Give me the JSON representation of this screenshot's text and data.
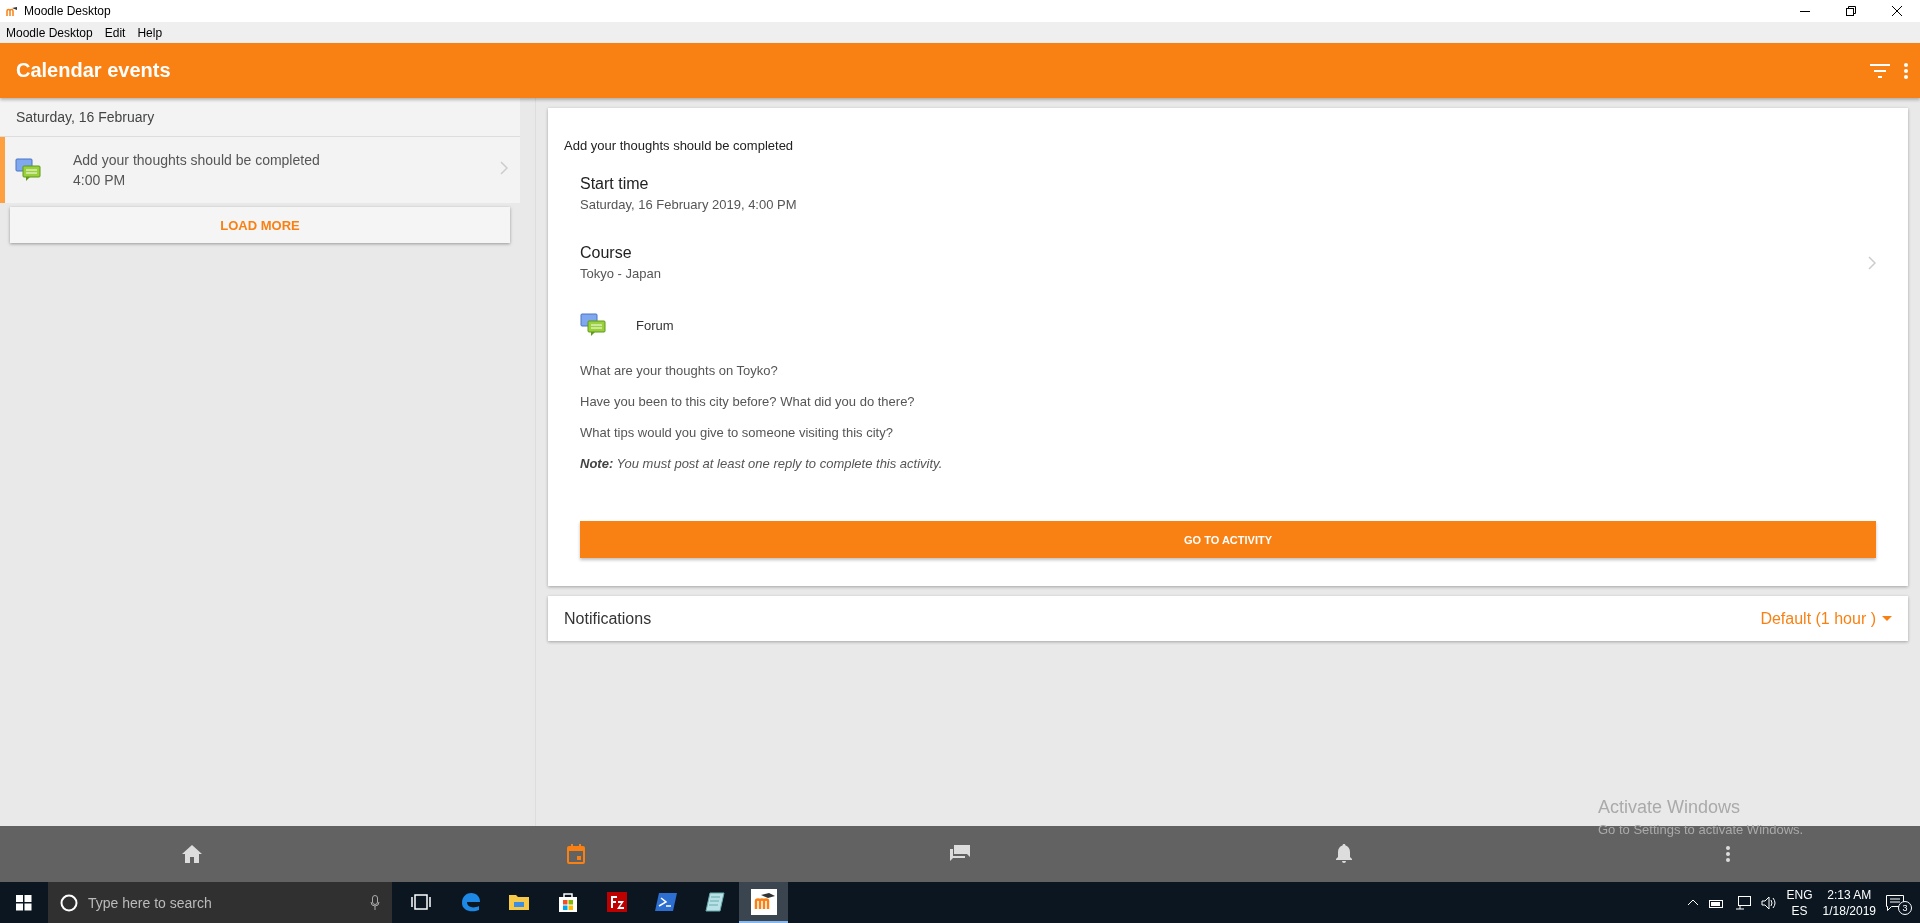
{
  "window": {
    "title": "Moodle Desktop"
  },
  "menu": [
    "Moodle Desktop",
    "Edit",
    "Help"
  ],
  "header": {
    "title": "Calendar events"
  },
  "event_list": {
    "date": "Saturday, 16 February",
    "items": [
      {
        "title": "Add your thoughts should be completed",
        "time": "4:00 PM",
        "selected": true
      }
    ],
    "load_more": "LOAD MORE"
  },
  "detail": {
    "title": "Add your thoughts should be completed",
    "fields": [
      {
        "label": "Start time",
        "value": "Saturday, 16 February 2019, 4:00 PM",
        "link": false
      },
      {
        "label": "Course",
        "value": "Tokyo - Japan",
        "link": true
      }
    ],
    "module": "Forum",
    "description": [
      "What are your thoughts on Toyko?",
      "Have you been to this city before? What did you do there?",
      "What tips would you give to someone visiting this city?",
      "**Note:** You must post at least one reply to complete this activity."
    ],
    "action": "GO TO ACTIVITY"
  },
  "notifications": {
    "label": "Notifications",
    "value": "Default (1 hour )"
  },
  "bottom_nav": [
    {
      "kind": "home",
      "selected": false
    },
    {
      "kind": "calendar",
      "selected": true
    },
    {
      "kind": "messages",
      "selected": false
    },
    {
      "kind": "bell",
      "selected": false
    },
    {
      "kind": "more",
      "selected": false
    }
  ],
  "watermark": {
    "title": "Activate Windows",
    "subtitle": "Go to Settings to activate Windows."
  },
  "taskbar": {
    "search_placeholder": "Type here to search",
    "apps": [
      {
        "kind": "taskview",
        "selected": false
      },
      {
        "kind": "edge",
        "selected": false
      },
      {
        "kind": "explorer",
        "selected": false
      },
      {
        "kind": "store",
        "selected": false
      },
      {
        "kind": "filezilla",
        "selected": false
      },
      {
        "kind": "powershell",
        "selected": false
      },
      {
        "kind": "notes",
        "selected": false
      },
      {
        "kind": "moodle",
        "selected": true
      }
    ],
    "language": "ENG",
    "layout": "ES",
    "time": "2:13 AM",
    "date": "1/18/2019",
    "notification_count": "3"
  }
}
